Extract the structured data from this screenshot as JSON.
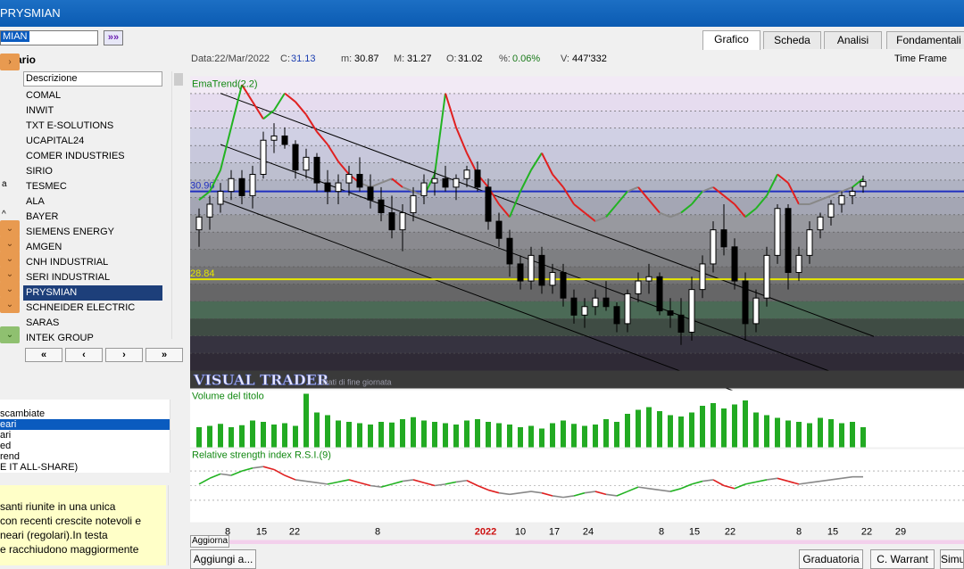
{
  "window": {
    "title": "PRYSMIAN"
  },
  "search": {
    "value": "MIAN",
    "go_label": "»»"
  },
  "dizionario": {
    "label": "ionario"
  },
  "list": {
    "header": "Descrizione",
    "items": [
      "COMAL",
      "INWIT",
      "TXT E-SOLUTIONS",
      "UCAPITAL24",
      "COMER INDUSTRIES",
      "SIRIO",
      "TESMEC",
      "ALA",
      "BAYER",
      "SIEMENS ENERGY",
      "AMGEN",
      "CNH INDUSTRIAL",
      "SERI INDUSTRIAL",
      "PRYSMIAN",
      "SCHNEIDER ELECTRIC",
      "SARAS",
      "INTEK GROUP"
    ],
    "selected_index": 13,
    "left_marks": [
      "",
      "",
      "",
      "",
      "",
      "",
      "a",
      "",
      "^",
      "",
      "",
      "",
      "",
      "",
      "",
      "",
      ""
    ]
  },
  "nav": {
    "first": "«",
    "prev": "‹",
    "next": "›",
    "last": "»"
  },
  "panel2": {
    "items": [
      "scambiate",
      "eari",
      "ari",
      "ed",
      "rend",
      "E IT ALL-SHARE)"
    ],
    "selected_index": 1
  },
  "description": {
    "lines": [
      "santi riunite in una unica",
      "con recenti crescite notevoli e",
      "neari (regolari).In testa",
      "e racchiudono maggiormente"
    ]
  },
  "tabs": [
    "Grafico",
    "Scheda",
    "Analisi",
    "Fondamentali"
  ],
  "active_tab": 0,
  "infobar": {
    "data": "Data:22/Mar/2022",
    "c_label": "C:",
    "c": "31.13",
    "m_label": "m:",
    "m": "30.87",
    "M_label": "M:",
    "M": "31.27",
    "o_label": "O:",
    "o": "31.02",
    "pct_label": "%:",
    "pct": "0.06%",
    "v_label": "V:",
    "v": "447'332",
    "timeframe": "Time Frame"
  },
  "chart_data": [
    {
      "type": "candlestick",
      "title": "EmaTrend(2.2)",
      "levels": [
        {
          "label": "30.90",
          "value": 30.9,
          "color": "#1f2fbf"
        },
        {
          "label": "28.84",
          "value": 28.84,
          "color": "#e6e600"
        }
      ],
      "ylim": [
        26.7,
        33.6
      ],
      "watermark": "VISUAL TRADER",
      "watermark_sub": "Dati di fine giornata",
      "candles": [
        [
          30.0,
          30.5,
          29.6,
          30.3
        ],
        [
          30.3,
          30.8,
          30.0,
          30.6
        ],
        [
          30.6,
          31.1,
          30.4,
          30.9
        ],
        [
          30.9,
          31.4,
          30.7,
          31.2
        ],
        [
          31.2,
          31.4,
          30.6,
          30.8
        ],
        [
          30.8,
          31.5,
          30.5,
          31.3
        ],
        [
          31.3,
          32.3,
          31.2,
          32.1
        ],
        [
          32.1,
          32.5,
          31.8,
          32.2
        ],
        [
          32.2,
          32.4,
          31.9,
          32.0
        ],
        [
          32.0,
          32.1,
          31.2,
          31.4
        ],
        [
          31.4,
          31.9,
          31.2,
          31.7
        ],
        [
          31.7,
          31.8,
          30.9,
          31.1
        ],
        [
          31.1,
          31.4,
          30.6,
          30.9
        ],
        [
          30.9,
          31.3,
          30.6,
          31.1
        ],
        [
          31.1,
          31.5,
          30.8,
          31.3
        ],
        [
          31.3,
          31.7,
          30.9,
          31.0
        ],
        [
          31.0,
          31.3,
          30.5,
          30.7
        ],
        [
          30.7,
          31.0,
          30.2,
          30.4
        ],
        [
          30.4,
          30.8,
          29.8,
          30.0
        ],
        [
          30.0,
          30.6,
          29.5,
          30.4
        ],
        [
          30.4,
          31.0,
          30.2,
          30.8
        ],
        [
          30.8,
          31.3,
          30.6,
          31.1
        ],
        [
          31.1,
          31.4,
          30.8,
          31.2
        ],
        [
          31.2,
          31.5,
          30.9,
          31.0
        ],
        [
          31.0,
          31.3,
          30.7,
          31.2
        ],
        [
          31.2,
          31.5,
          31.0,
          31.4
        ],
        [
          31.4,
          31.6,
          30.9,
          31.0
        ],
        [
          31.0,
          31.2,
          30.0,
          30.2
        ],
        [
          30.2,
          30.4,
          29.6,
          29.8
        ],
        [
          29.8,
          30.0,
          28.9,
          29.2
        ],
        [
          29.2,
          29.4,
          28.6,
          28.8
        ],
        [
          28.8,
          29.6,
          28.6,
          29.4
        ],
        [
          29.4,
          29.6,
          28.5,
          28.7
        ],
        [
          28.7,
          29.2,
          28.5,
          29.0
        ],
        [
          29.0,
          29.2,
          28.2,
          28.4
        ],
        [
          28.4,
          28.6,
          27.8,
          28.0
        ],
        [
          28.0,
          28.4,
          27.7,
          28.2
        ],
        [
          28.2,
          28.6,
          28.0,
          28.4
        ],
        [
          28.4,
          28.8,
          28.1,
          28.2
        ],
        [
          28.2,
          28.3,
          27.6,
          27.8
        ],
        [
          27.8,
          28.6,
          27.6,
          28.5
        ],
        [
          28.5,
          29.0,
          28.3,
          28.8
        ],
        [
          28.8,
          29.2,
          28.5,
          28.9
        ],
        [
          28.9,
          29.0,
          28.0,
          28.1
        ],
        [
          28.1,
          28.4,
          27.7,
          28.0
        ],
        [
          28.0,
          28.4,
          27.3,
          27.6
        ],
        [
          27.6,
          28.9,
          27.4,
          28.6
        ],
        [
          28.6,
          29.4,
          28.4,
          29.2
        ],
        [
          29.2,
          30.2,
          29.0,
          30.0
        ],
        [
          30.0,
          30.6,
          29.4,
          29.6
        ],
        [
          29.6,
          29.8,
          28.6,
          28.8
        ],
        [
          28.8,
          29.0,
          27.4,
          27.8
        ],
        [
          27.8,
          28.6,
          27.6,
          28.4
        ],
        [
          28.4,
          29.6,
          28.2,
          29.4
        ],
        [
          29.4,
          30.6,
          29.2,
          30.5
        ],
        [
          30.5,
          30.6,
          28.6,
          29.0
        ],
        [
          29.0,
          29.6,
          28.8,
          29.4
        ],
        [
          29.4,
          30.2,
          29.2,
          30.0
        ],
        [
          30.0,
          30.4,
          29.8,
          30.3
        ],
        [
          30.3,
          30.7,
          30.1,
          30.6
        ],
        [
          30.6,
          30.9,
          30.4,
          30.8
        ],
        [
          30.8,
          31.0,
          30.6,
          30.9
        ],
        [
          31.02,
          31.27,
          30.87,
          31.13
        ]
      ],
      "ema_trend": [
        30.7,
        30.9,
        31.4,
        32.4,
        33.4,
        33.0,
        32.6,
        32.8,
        33.2,
        33.0,
        32.7,
        32.3,
        32.0,
        31.6,
        31.3,
        31.1,
        31.0,
        31.1,
        31.2,
        31.0,
        30.9,
        30.8,
        31.3,
        33.2,
        32.4,
        31.8,
        31.3,
        31.0,
        30.6,
        30.3,
        30.9,
        31.4,
        31.8,
        31.3,
        31.0,
        30.6,
        30.4,
        30.2,
        30.3,
        30.6,
        30.9,
        31.0,
        30.7,
        30.4,
        30.3,
        30.4,
        30.6,
        30.9,
        31.0,
        30.8,
        30.6,
        30.3,
        30.5,
        30.8,
        31.3,
        31.1,
        30.6,
        30.6,
        30.7,
        30.8,
        30.9,
        31.0,
        31.2
      ]
    },
    {
      "type": "bar",
      "title": "Volume del titolo",
      "values": [
        30,
        32,
        35,
        30,
        33,
        40,
        38,
        34,
        36,
        32,
        80,
        52,
        48,
        40,
        38,
        36,
        34,
        38,
        37,
        42,
        45,
        40,
        38,
        36,
        34,
        40,
        42,
        38,
        36,
        34,
        30,
        32,
        28,
        36,
        40,
        35,
        32,
        34,
        42,
        38,
        50,
        56,
        60,
        54,
        48,
        46,
        52,
        62,
        66,
        58,
        64,
        70,
        52,
        48,
        44,
        40,
        38,
        36,
        44,
        42,
        36,
        38,
        30
      ]
    },
    {
      "type": "line",
      "title": "Relative strength index R.S.I.(9)",
      "values": [
        52,
        60,
        66,
        64,
        70,
        74,
        76,
        72,
        64,
        58,
        56,
        54,
        52,
        55,
        58,
        54,
        50,
        48,
        52,
        56,
        58,
        54,
        50,
        52,
        55,
        57,
        50,
        44,
        40,
        38,
        40,
        42,
        40,
        36,
        34,
        36,
        40,
        42,
        38,
        36,
        42,
        48,
        46,
        44,
        42,
        46,
        52,
        56,
        58,
        50,
        46,
        52,
        55,
        58,
        60,
        56,
        52,
        54,
        56,
        58,
        60,
        62,
        62
      ]
    }
  ],
  "xaxis": {
    "ticks": [
      "8",
      "15",
      "22",
      "8",
      "2022",
      "10",
      "17",
      "24",
      "8",
      "15",
      "22",
      "8",
      "15",
      "22",
      "29"
    ],
    "year_tick": "2022"
  },
  "bottom": {
    "aggiorna": "Aggiorna",
    "aggiungi": "Aggiungi a...",
    "graduatoria": "Graduatoria",
    "cwarrant": "C. Warrant",
    "simul": "Simul"
  },
  "colors": {
    "chart_bg": "#b9bcc9",
    "up_segment": "#22b322",
    "down_segment": "#e02020",
    "neutral_segment": "#888888"
  }
}
